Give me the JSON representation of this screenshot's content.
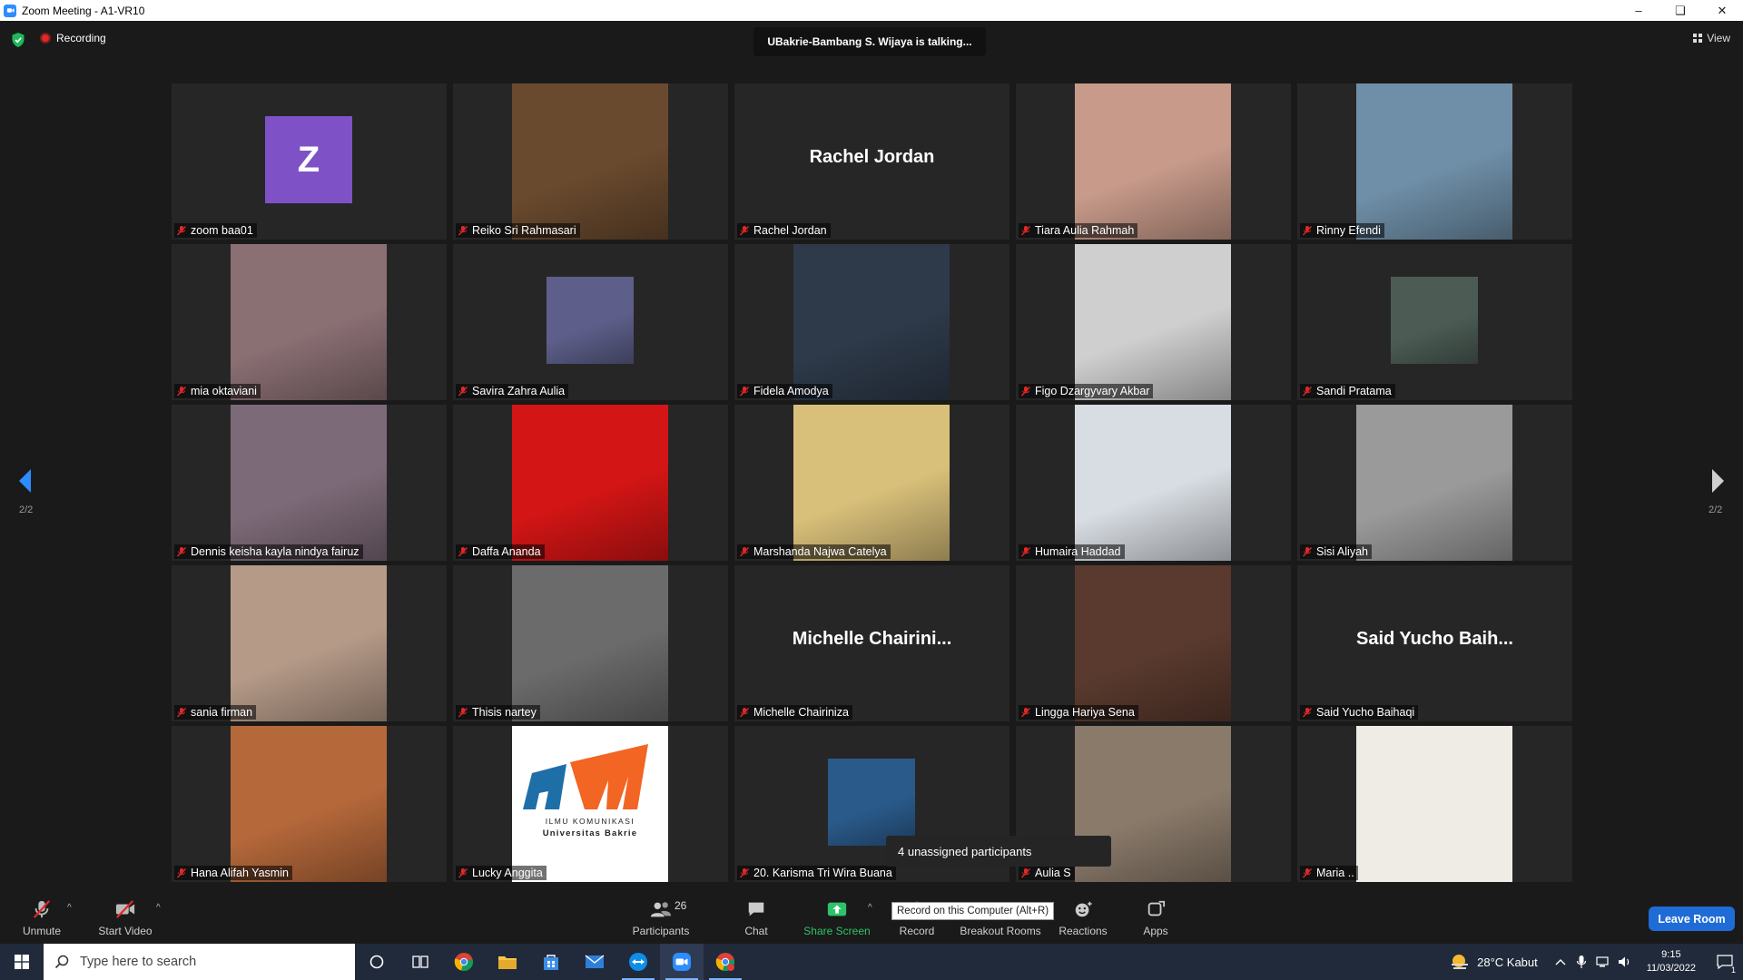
{
  "window": {
    "title": "Zoom Meeting - A1-VR10",
    "minimize": "–",
    "restore": "❏",
    "close": "✕"
  },
  "meeting": {
    "recording_label": "Recording",
    "talking": "UBakrie-Bambang S. Wijaya is talking...",
    "view_label": "View",
    "page_left": "2/2",
    "page_right": "2/2",
    "unassigned": "4 unassigned participants"
  },
  "tiles": [
    {
      "name": "zoom baa01",
      "kind": "avatar",
      "initial": "Z"
    },
    {
      "name": "Reiko Sri Rahmasari",
      "kind": "video",
      "color": "#6a4a2e"
    },
    {
      "name": "Rachel Jordan",
      "kind": "text",
      "big_name": "Rachel Jordan"
    },
    {
      "name": "Tiara Aulia Rahmah",
      "kind": "video",
      "color": "#c79a8a"
    },
    {
      "name": "Rinny Efendi",
      "kind": "video",
      "color": "#6f8fa8"
    },
    {
      "name": "mia oktaviani",
      "kind": "video",
      "color": "#8a6f73"
    },
    {
      "name": "Savira Zahra Aulia",
      "kind": "small",
      "color": "#5d5f8a"
    },
    {
      "name": "Fidela Amodya",
      "kind": "video",
      "color": "#2e3a4a"
    },
    {
      "name": "Figo Dzargyvary Akbar",
      "kind": "video",
      "color": "#cfcfcf"
    },
    {
      "name": "Sandi Pratama",
      "kind": "small",
      "color": "#4c5c55"
    },
    {
      "name": "Dennis keisha kayla nindya fairuz",
      "kind": "video",
      "color": "#7d6a78"
    },
    {
      "name": "Daffa Ananda",
      "kind": "video",
      "color": "#d41515"
    },
    {
      "name": "Marshanda Najwa Catelya",
      "kind": "video",
      "color": "#d9c07a"
    },
    {
      "name": "Humaira Haddad",
      "kind": "video",
      "color": "#d8dde3"
    },
    {
      "name": "Sisi Aliyah",
      "kind": "video",
      "color": "#9a9a9a"
    },
    {
      "name": "sania firman",
      "kind": "video",
      "color": "#b59a88"
    },
    {
      "name": "Thisis nartey",
      "kind": "video",
      "color": "#6b6b6b"
    },
    {
      "name": "Michelle Chairiniza",
      "kind": "text",
      "big_name": "Michelle  Chairini..."
    },
    {
      "name": "Lingga Hariya Sena",
      "kind": "video",
      "color": "#5a3a2e"
    },
    {
      "name": "Said Yucho Baihaqi",
      "kind": "text",
      "big_name": "Said Yucho Baih..."
    },
    {
      "name": "Hana Alifah Yasmin",
      "kind": "video",
      "color": "#b5683a"
    },
    {
      "name": "Lucky Anggita",
      "kind": "logo",
      "color": "#ffffff",
      "logo_text_1": "ILMU KOMUNIKASI",
      "logo_text_2": "Universitas Bakrie"
    },
    {
      "name": "20. Karisma Tri Wira Buana",
      "kind": "small",
      "color": "#2a5a8a"
    },
    {
      "name": "Aulia S",
      "kind": "video",
      "color": "#8a7a6a"
    },
    {
      "name": "Maria ..",
      "kind": "video",
      "color": "#efece6"
    }
  ],
  "toolbar": {
    "unmute": "Unmute",
    "start_video": "Start Video",
    "participants": "Participants",
    "participants_count": "26",
    "chat": "Chat",
    "share_screen": "Share Screen",
    "record": "Record",
    "record_tooltip": "Record on this Computer (Alt+R)",
    "breakout": "Breakout Rooms",
    "reactions": "Reactions",
    "apps": "Apps",
    "leave": "Leave Room"
  },
  "taskbar": {
    "search_placeholder": "Type here to search",
    "weather": "28°C  Kabut",
    "time": "9:15",
    "date": "11/03/2022",
    "notification_count": "1"
  },
  "colors": {
    "accent": "#2d8cff",
    "share_green": "#2ec36a",
    "leave_blue": "#1f6cd6",
    "muted_red": "#e02828"
  }
}
